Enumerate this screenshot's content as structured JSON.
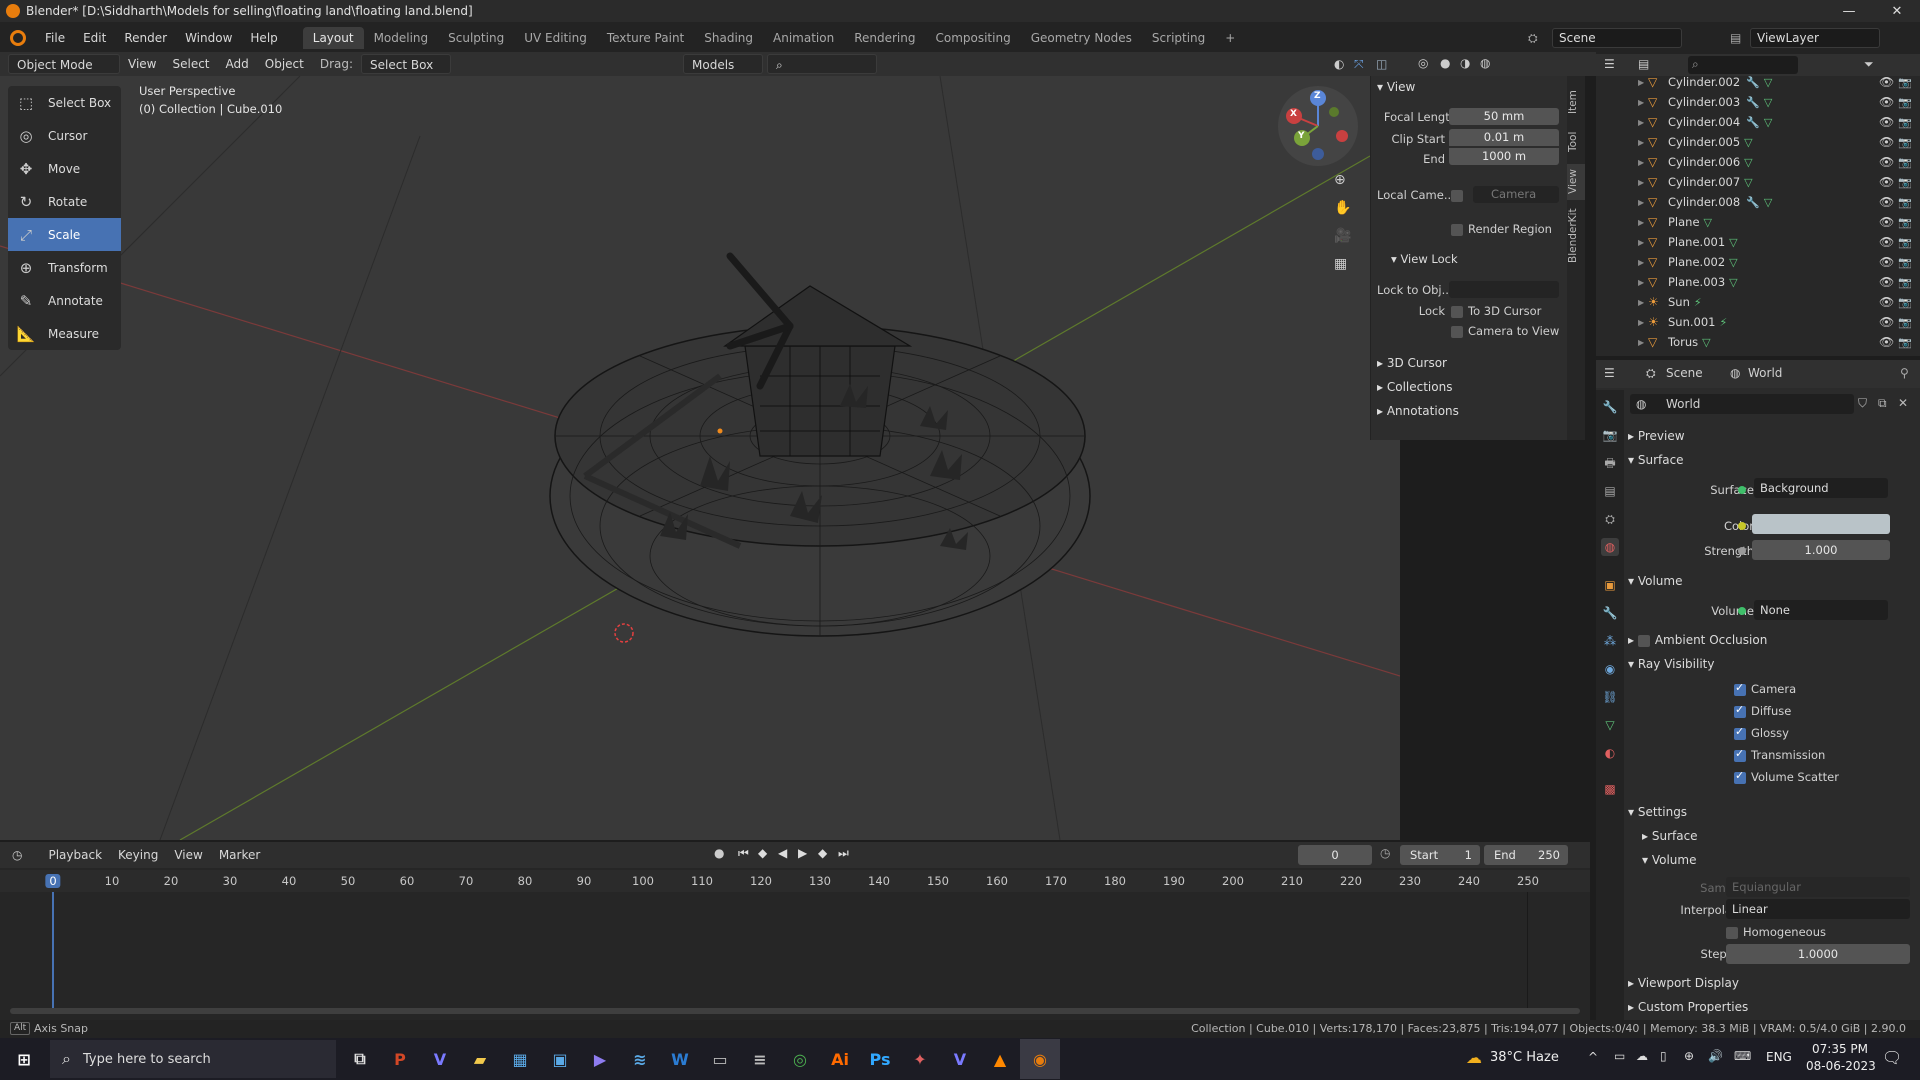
{
  "window": {
    "title": "Blender* [D:\\Siddharth\\Models for selling\\floating land\\floating land.blend]",
    "min": "—",
    "max": "❐",
    "close": "✕"
  },
  "menus": [
    "File",
    "Edit",
    "Render",
    "Window",
    "Help"
  ],
  "workspaces": [
    "Layout",
    "Modeling",
    "Sculpting",
    "UV Editing",
    "Texture Paint",
    "Shading",
    "Animation",
    "Rendering",
    "Compositing",
    "Geometry Nodes",
    "Scripting",
    "+"
  ],
  "scene": {
    "name": "Scene",
    "view_layer": "ViewLayer"
  },
  "header": {
    "mode": "Object Mode",
    "view": "View",
    "select": "Select",
    "add": "Add",
    "object": "Object",
    "drag_label": "Drag:",
    "drag_value": "Select Box",
    "collection": "Models"
  },
  "tools": [
    {
      "label": "Select Box",
      "icon": "⬚",
      "active": false
    },
    {
      "label": "Cursor",
      "icon": "◎",
      "active": false
    },
    {
      "label": "Move",
      "icon": "✥",
      "active": false
    },
    {
      "label": "Rotate",
      "icon": "↻",
      "active": false
    },
    {
      "label": "Scale",
      "icon": "⤢",
      "active": true
    },
    {
      "label": "Transform",
      "icon": "⊕",
      "active": false
    },
    {
      "label": "Annotate",
      "icon": "✎",
      "active": false
    },
    {
      "label": "Measure",
      "icon": "📐",
      "active": false
    }
  ],
  "viewport": {
    "perspective": "User Perspective",
    "context": "(0) Collection | Cube.010",
    "gizmo": {
      "x": "X",
      "y": "Y",
      "z": "Z"
    }
  },
  "npanel": {
    "tabs": [
      "Item",
      "Tool",
      "View",
      "BlenderKit"
    ],
    "view_header": "View",
    "focal_label": "Focal Length",
    "focal_value": "50 mm",
    "clip_start_label": "Clip Start",
    "clip_start_value": "0.01 m",
    "end_label": "End",
    "end_value": "1000 m",
    "local_cam_label": "Local Came...",
    "camera_placeholder": "Camera",
    "render_region": "Render Region",
    "view_lock_header": "View Lock",
    "lock_to_obj_label": "Lock to Obj...",
    "lock_label": "Lock",
    "to_3d_cursor": "To 3D Cursor",
    "camera_to_view": "Camera to View",
    "cursor_header": "3D Cursor",
    "collections_header": "Collections",
    "annotations_header": "Annotations"
  },
  "outliner": [
    {
      "name": "Cylinder.002",
      "modifier": true
    },
    {
      "name": "Cylinder.003",
      "modifier": true
    },
    {
      "name": "Cylinder.004",
      "modifier": true
    },
    {
      "name": "Cylinder.005",
      "modifier": false
    },
    {
      "name": "Cylinder.006",
      "modifier": false
    },
    {
      "name": "Cylinder.007",
      "modifier": false
    },
    {
      "name": "Cylinder.008",
      "modifier": true
    },
    {
      "name": "Plane",
      "modifier": false
    },
    {
      "name": "Plane.001",
      "modifier": false
    },
    {
      "name": "Plane.002",
      "modifier": false
    },
    {
      "name": "Plane.003",
      "modifier": false
    },
    {
      "name": "Sun",
      "modifier": false
    },
    {
      "name": "Sun.001",
      "modifier": false
    },
    {
      "name": "Torus",
      "modifier": false
    }
  ],
  "properties": {
    "breadcrumb_scene": "Scene",
    "breadcrumb_world": "World",
    "world_name": "World",
    "preview": "Preview",
    "surface_header": "Surface",
    "surface_label": "Surface",
    "surface_value": "Background",
    "color_label": "Color",
    "color_value": "#b9c3c8",
    "strength_label": "Strength",
    "strength_value": "1.000",
    "volume_header": "Volume",
    "volume_label": "Volume",
    "volume_value": "None",
    "ao_header": "Ambient Occlusion",
    "ray_header": "Ray Visibility",
    "ray_items": [
      "Camera",
      "Diffuse",
      "Glossy",
      "Transmission",
      "Volume Scatter"
    ],
    "settings_header": "Settings",
    "settings_surface": "Surface",
    "settings_volume": "Volume",
    "sampling_label": "Sampling",
    "sampling_value": "Equiangular",
    "interp_label": "Interpolation",
    "interp_value": "Linear",
    "homogeneous": "Homogeneous",
    "step_label": "Step Size",
    "step_value": "1.0000",
    "viewport_display": "Viewport Display",
    "custom_props": "Custom Properties"
  },
  "timeline": {
    "playback": "Playback",
    "keying": "Keying",
    "view": "View",
    "marker": "Marker",
    "current_frame": "0",
    "start_label": "Start",
    "start_value": "1",
    "end_label": "End",
    "end_value": "250",
    "ticks": [
      "0",
      "10",
      "20",
      "30",
      "40",
      "50",
      "60",
      "70",
      "80",
      "90",
      "100",
      "110",
      "120",
      "130",
      "140",
      "150",
      "160",
      "170",
      "180",
      "190",
      "200",
      "210",
      "220",
      "230",
      "240",
      "250"
    ]
  },
  "status": {
    "left": "Axis Snap",
    "right": "Collection | Cube.010 | Verts:178,170 | Faces:23,875 | Tris:194,077 | Objects:0/40 | Memory: 38.3 MiB | VRAM: 0.5/4.0 GiB | 2.90.0"
  },
  "taskbar": {
    "search_placeholder": "Type here to search",
    "weather": "38°C  Haze",
    "lang": "ENG",
    "time": "07:35 PM",
    "date": "08-06-2023"
  }
}
